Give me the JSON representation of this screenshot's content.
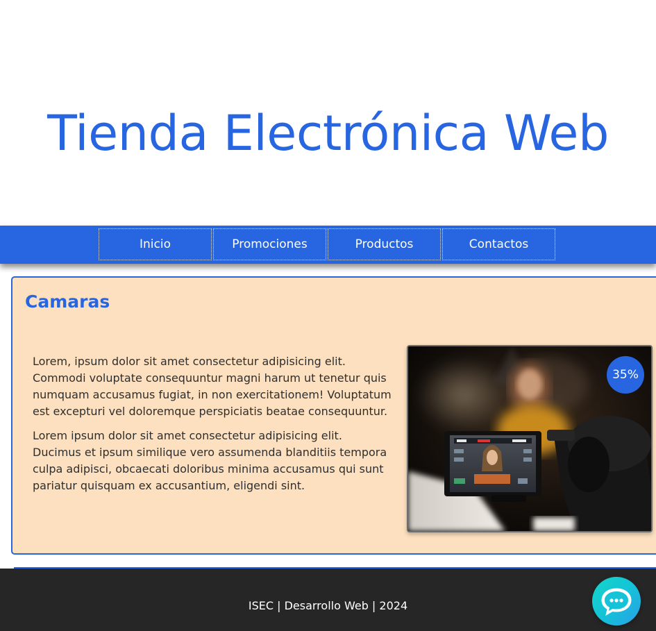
{
  "header": {
    "title": "Tienda Electrónica Web"
  },
  "nav": {
    "items": [
      {
        "label": "Inicio"
      },
      {
        "label": "Promociones"
      },
      {
        "label": "Productos"
      },
      {
        "label": "Contactos"
      }
    ]
  },
  "section": {
    "title": "Camaras",
    "paragraphs": [
      "Lorem, ipsum dolor sit amet consectetur adipisicing elit. Commodi voluptate consequuntur magni harum ut tenetur quis numquam accusamus fugiat, in non exercitationem! Voluptatum est excepturi vel doloremque perspiciatis beatae consequuntur.",
      "Lorem ipsum dolor sit amet consectetur adipisicing elit. Ducimus et ipsum similique vero assumenda blanditiis tempora culpa adipisci, obcaecati doloribus minima accusamus qui sunt pariatur quisquam ex accusantium, eligendi sint."
    ],
    "product": {
      "discount": "35%"
    }
  },
  "footer": {
    "text": "ISEC | Desarrollo Web | 2024"
  },
  "colors": {
    "accent": "#2766e0",
    "section_background": "#fde0bf",
    "footer_background": "#262626",
    "chat_button": "#14c3d8"
  },
  "icons": {
    "chat": "chat-bubble-icon"
  }
}
